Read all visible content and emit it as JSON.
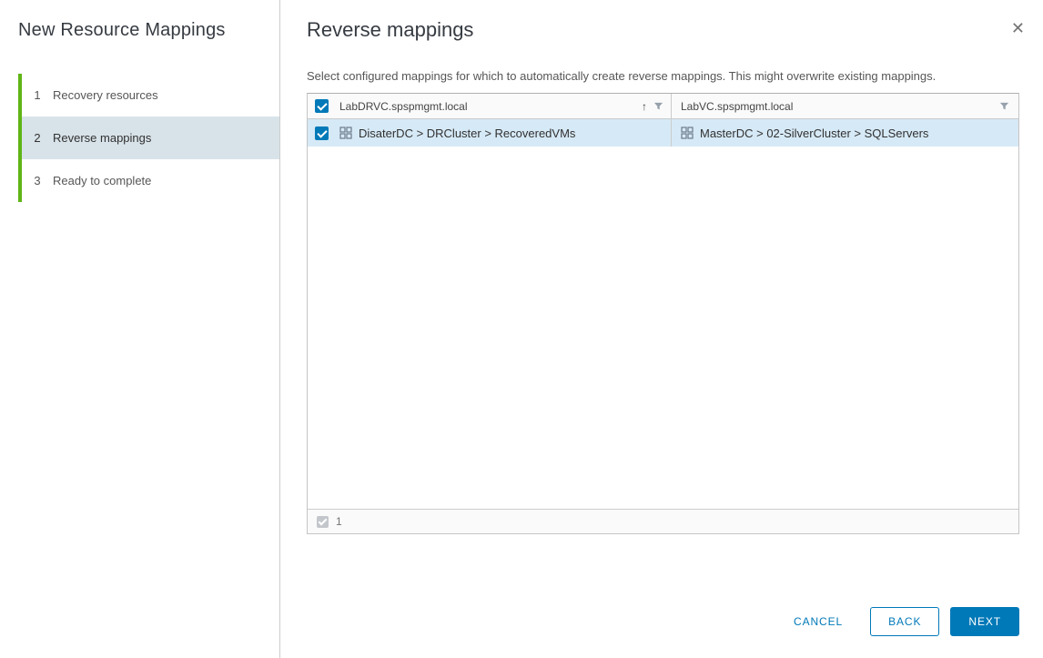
{
  "colors": {
    "accent_blue": "#0079b8",
    "step_bar_green": "#60b515",
    "active_step_bg": "#d8e3e9",
    "selected_row_bg": "#d6e9f6"
  },
  "wizard": {
    "title": "New Resource Mappings",
    "steps": [
      {
        "number": "1",
        "label": "Recovery resources"
      },
      {
        "number": "2",
        "label": "Reverse mappings"
      },
      {
        "number": "3",
        "label": "Ready to complete"
      }
    ]
  },
  "panel": {
    "title": "Reverse mappings",
    "close_icon": "✕",
    "description": "Select configured mappings for which to automatically create reverse mappings. This might overwrite existing mappings."
  },
  "grid": {
    "columns": [
      {
        "header": "LabDRVC.spspmgmt.local",
        "sort_icon": "↑"
      },
      {
        "header": "LabVC.spspmgmt.local"
      }
    ],
    "rows": [
      {
        "checked": true,
        "source": "DisaterDC > DRCluster > RecoveredVMs",
        "target": "MasterDC > 02-SilverCluster > SQLServers"
      }
    ],
    "footer": {
      "selected_count": "1"
    }
  },
  "actions": {
    "cancel": "CANCEL",
    "back": "BACK",
    "next": "NEXT"
  }
}
